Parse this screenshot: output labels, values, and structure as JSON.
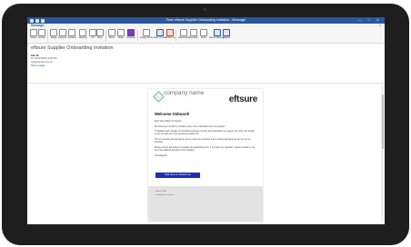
{
  "window": {
    "title": "Fwd: eftsure Supplier Onboarding Invitation - Message",
    "controls": "— □ ✕"
  },
  "ribbon": {
    "tab": "Message",
    "collapse": "∨",
    "buttons": [
      "Delete",
      "Archive",
      "Reply",
      "Reply All",
      "Forward",
      "Meeting",
      "IM",
      "More",
      "Move",
      "Rules",
      "OneNote",
      "Assign Policy",
      "Mark Unread",
      "Follow Up",
      "Read Aloud",
      "Translate",
      "Zoom",
      "Report Message",
      "Insights"
    ]
  },
  "message": {
    "subject": "eftsure Supplier Onboarding Invitation",
    "sender": "Info W",
    "date": "Fri 14/12/2018 10:00 AM",
    "to": "test@vendor.com.au",
    "notice": "Show images"
  },
  "email": {
    "company_name": "company name",
    "brand": "eftsure",
    "heading": "Welcome Onboard!",
    "greeting": "Dear Value Matrix at Supplier",
    "paragraphs": [
      "We have been invited by company name to be onboarded as a new supplier.",
      "To facilitate and manage our financial processes, security and compliance we request you verify your details so we can add you to our approved supplier list.",
      "This is a regular process that we use to protect our business and to ensure payments are sent to you as intended.",
      "Please use the link below to complete the onboarding form. If you have any questions, please contact us via the email address provided in the invitation.",
      "Kind Regards,"
    ],
    "cta": "Click here to onboard now",
    "footer": [
      "eftsure 2018",
      "info@eftsure.com.au"
    ]
  }
}
